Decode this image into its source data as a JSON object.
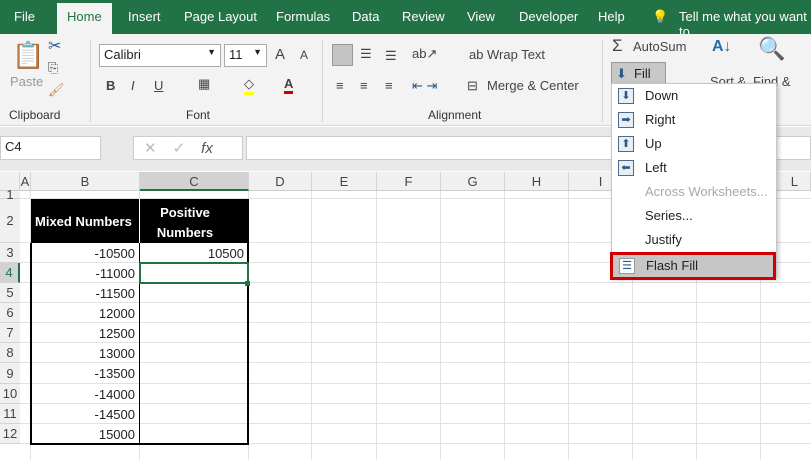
{
  "tabs": [
    "File",
    "Home",
    "Insert",
    "Page Layout",
    "Formulas",
    "Data",
    "Review",
    "View",
    "Developer",
    "Help",
    "Tell me what you want to"
  ],
  "ribbon": {
    "paste": "Paste",
    "clipboard": "Clipboard",
    "font_name": "Calibri",
    "font_size": "11",
    "font_group": "Font",
    "bold": "B",
    "italic": "I",
    "underline": "U",
    "wrap_text": "Wrap Text",
    "merge_center": "Merge & Center",
    "alignment": "Alignment",
    "autosum": "AutoSum",
    "fill": "Fill",
    "sort": "Sort &",
    "find": "Find &"
  },
  "formula_bar": {
    "name_box": "C4",
    "fx": "fx",
    "value": ""
  },
  "columns": [
    "A",
    "B",
    "C",
    "D",
    "E",
    "F",
    "G",
    "H",
    "I",
    "L"
  ],
  "rows": [
    "1",
    "2",
    "3",
    "4",
    "5",
    "6",
    "7",
    "8",
    "9",
    "10",
    "11",
    "12"
  ],
  "table": {
    "headers": [
      "Mixed Numbers",
      "Positive Numbers"
    ],
    "b_values": [
      "-10500",
      "-11000",
      "-11500",
      "12000",
      "12500",
      "13000",
      "-13500",
      "-14000",
      "-14500",
      "15000"
    ],
    "c_values": [
      "10500"
    ]
  },
  "fill_menu": {
    "items": [
      {
        "label": "Down",
        "icon": "arrow-down"
      },
      {
        "label": "Right",
        "icon": "arrow-right"
      },
      {
        "label": "Up",
        "icon": "arrow-up"
      },
      {
        "label": "Left",
        "icon": "arrow-left"
      },
      {
        "label": "Across Worksheets...",
        "disabled": true
      },
      {
        "label": "Series..."
      },
      {
        "label": "Justify"
      },
      {
        "label": "Flash Fill",
        "highlighted": true
      }
    ]
  },
  "colors": {
    "brand": "#217346",
    "highlight": "#d00000"
  }
}
